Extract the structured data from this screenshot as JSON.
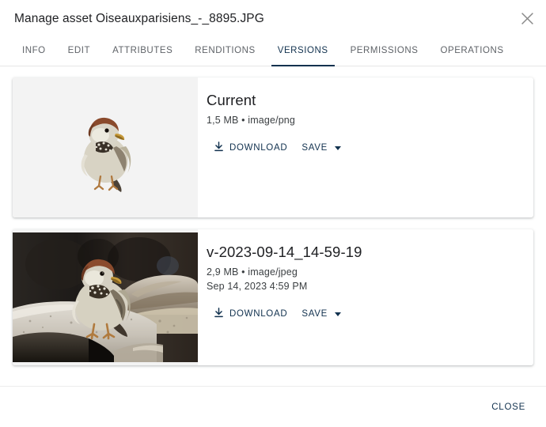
{
  "dialog": {
    "title": "Manage asset Oiseauxparisiens_-_8895.JPG",
    "close_icon": "close-icon"
  },
  "tabs": [
    {
      "label": "INFO",
      "active": false
    },
    {
      "label": "EDIT",
      "active": false
    },
    {
      "label": "ATTRIBUTES",
      "active": false
    },
    {
      "label": "RENDITIONS",
      "active": false
    },
    {
      "label": "VERSIONS",
      "active": true
    },
    {
      "label": "PERMISSIONS",
      "active": false
    },
    {
      "label": "OPERATIONS",
      "active": false
    }
  ],
  "versions": [
    {
      "name": "Current",
      "meta": "1,5 MB • image/png",
      "date": "",
      "download_label": "DOWNLOAD",
      "save_label": "SAVE",
      "thumbnail": "sparrow-cutout-on-white"
    },
    {
      "name": "v-2023-09-14_14-59-19",
      "meta": "2,9 MB • image/jpeg",
      "date": "Sep 14, 2023 4:59 PM",
      "download_label": "DOWNLOAD",
      "save_label": "SAVE",
      "thumbnail": "sparrow-on-stone-ledge"
    }
  ],
  "footer": {
    "close_label": "CLOSE"
  },
  "colors": {
    "accent": "#12324f",
    "text_primary": "#202124",
    "text_secondary": "#5f6368",
    "thumb_bg": "#f3f3f3",
    "divider": "#e6e6e6"
  }
}
